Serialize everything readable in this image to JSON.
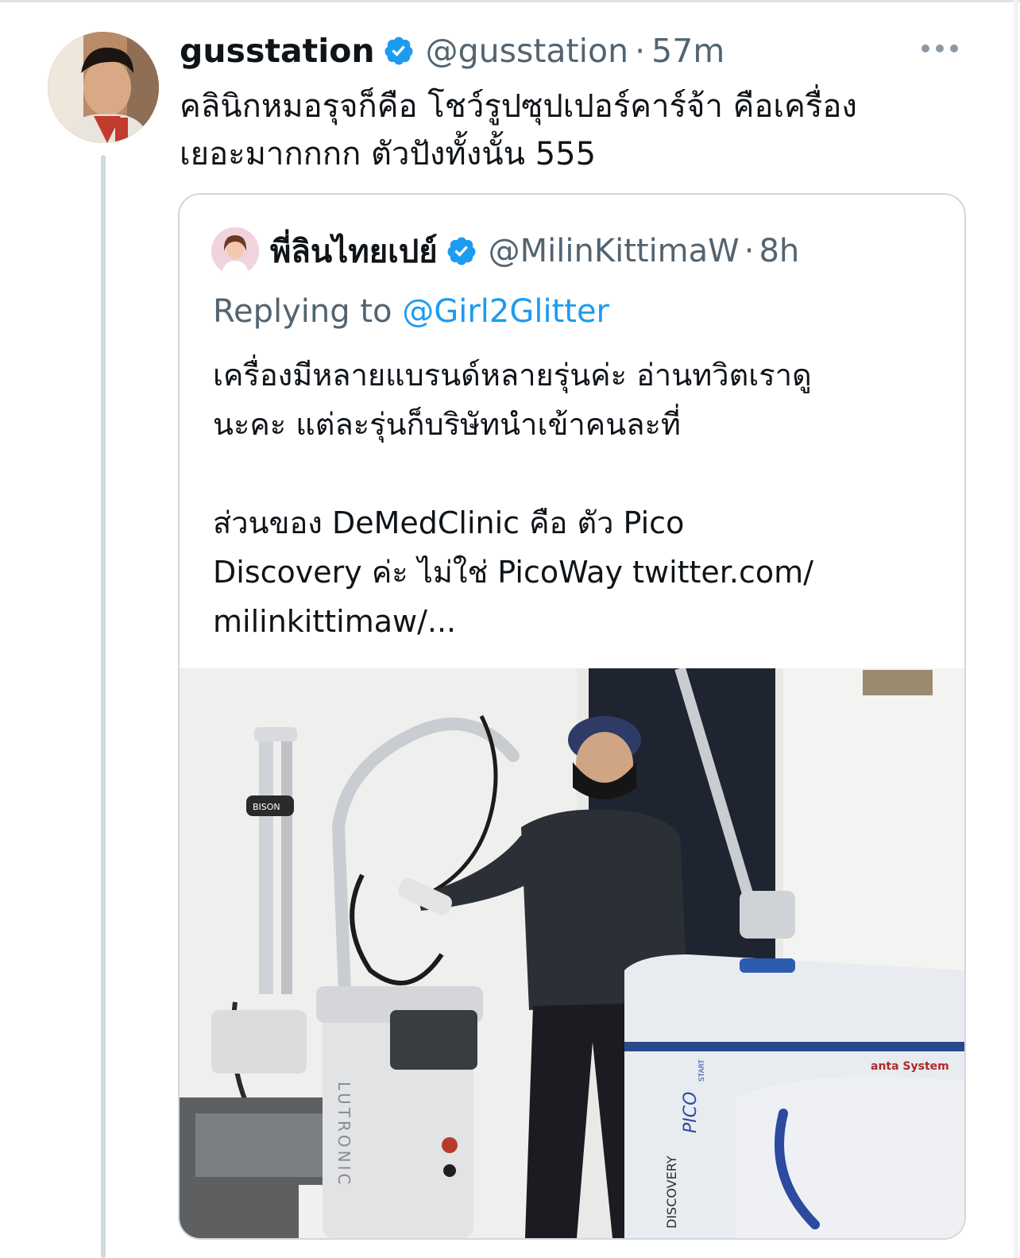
{
  "tweet": {
    "author_name": "gusstation",
    "author_handle": "@gusstation",
    "separator": "·",
    "time": "57m",
    "text_lines": [
      "คลินิกหมอรุจก็คือ โชว์รูปซุปเปอร์คาร์จ้า  คือเครื่อง",
      "เยอะมากกกก ตัวปังทั้งนั้น 555"
    ]
  },
  "quoted": {
    "author_name": "พี่ลินไทยเปย์",
    "author_handle": "@MilinKittimaW",
    "separator": "·",
    "time": "8h",
    "replying_prefix": "Replying to ",
    "replying_handle": "@Girl2Glitter",
    "text_lines_1": [
      "เครื่องมีหลายแบรนด์หลายรุ่นค่ะ อ่านทวิตเราดู",
      "นะคะ แต่ละรุ่นก็บริษัทนำเข้าคนละที่"
    ],
    "text_lines_2": [
      "ส่วนของ DeMedClinic  คือ ตัว Pico",
      "Discovery ค่ะ ไม่ใช่ PicoWay twitter.com/",
      "milinkittimaw/..."
    ],
    "photo_labels": {
      "lutronic": "LUTRONIC",
      "discovery": "DISCOVERY",
      "pico": "PICO",
      "start": "START",
      "quanta": "anta System",
      "bison": "BISON"
    }
  },
  "colors": {
    "verified": "#1d9bf0",
    "link": "#1d9bf0",
    "secondary_text": "#536471"
  },
  "icons": {
    "verified": "verified-badge-icon",
    "more": "more-horizontal-icon"
  }
}
